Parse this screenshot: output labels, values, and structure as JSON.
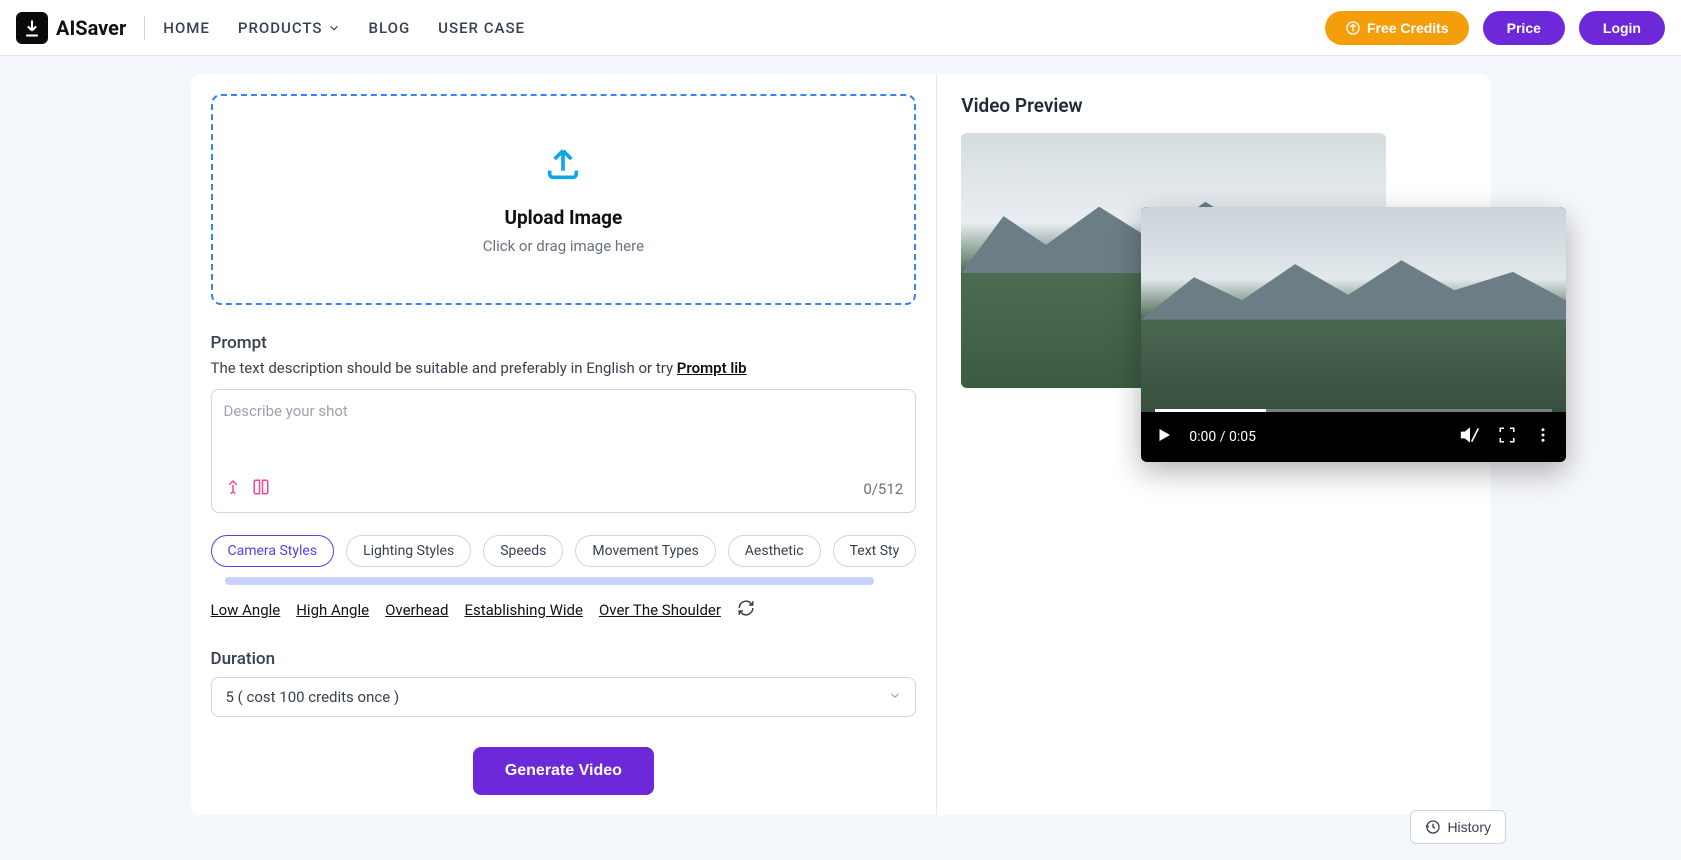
{
  "header": {
    "brand": "AISaver",
    "nav": {
      "home": "HOME",
      "products": "PRODUCTS",
      "blog": "BLOG",
      "usercase": "USER CASE"
    },
    "buttons": {
      "credits": "Free Credits",
      "price": "Price",
      "login": "Login"
    }
  },
  "upload": {
    "title": "Upload Image",
    "subtitle": "Click or drag image here"
  },
  "prompt": {
    "section_title": "Prompt",
    "hint_prefix": "The text description should be suitable and preferably in English or try ",
    "hint_link": "Prompt lib",
    "placeholder": "Describe your shot",
    "counter": "0/512"
  },
  "styles": {
    "tabs": [
      "Camera Styles",
      "Lighting Styles",
      "Speeds",
      "Movement Types",
      "Aesthetic",
      "Text Sty"
    ],
    "sub": [
      "Low Angle",
      "High Angle",
      "Overhead",
      "Establishing Wide",
      "Over The Shoulder"
    ]
  },
  "duration": {
    "label": "Duration",
    "selected": "5 ( cost 100 credits once )"
  },
  "generate": "Generate Video",
  "preview": {
    "title": "Video Preview",
    "time": "0:00 / 0:05"
  },
  "history": "History"
}
